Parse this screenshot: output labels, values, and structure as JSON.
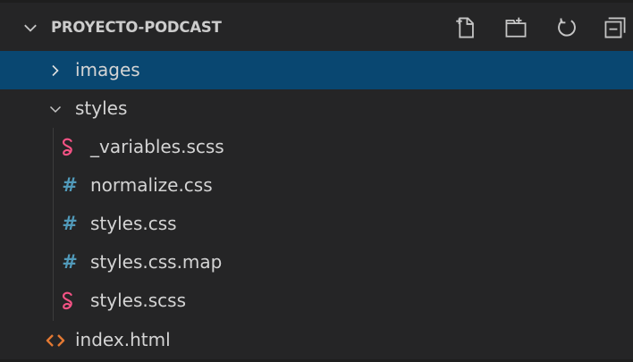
{
  "explorer": {
    "title": "PROYECTO-PODCAST",
    "actions": [
      "new-file-icon",
      "new-folder-icon",
      "refresh-icon",
      "collapse-all-icon"
    ],
    "items": [
      {
        "label": "images",
        "type": "folder",
        "expanded": false,
        "selected": true,
        "icon": "chevron-right-icon"
      },
      {
        "label": "styles",
        "type": "folder",
        "expanded": true,
        "selected": false,
        "icon": "chevron-down-icon"
      },
      {
        "label": "_variables.scss",
        "type": "file",
        "icon": "sass-icon"
      },
      {
        "label": "normalize.css",
        "type": "file",
        "icon": "css-icon"
      },
      {
        "label": "styles.css",
        "type": "file",
        "icon": "css-icon"
      },
      {
        "label": "styles.css.map",
        "type": "file",
        "icon": "css-icon"
      },
      {
        "label": "styles.scss",
        "type": "file",
        "icon": "sass-icon"
      },
      {
        "label": "index.html",
        "type": "file",
        "icon": "html-icon"
      }
    ]
  },
  "colors": {
    "background": "#252526",
    "selection": "#094771",
    "text": "#cccccc",
    "css_icon": "#519aba",
    "sass_icon": "#f55385",
    "html_icon": "#e37933"
  }
}
